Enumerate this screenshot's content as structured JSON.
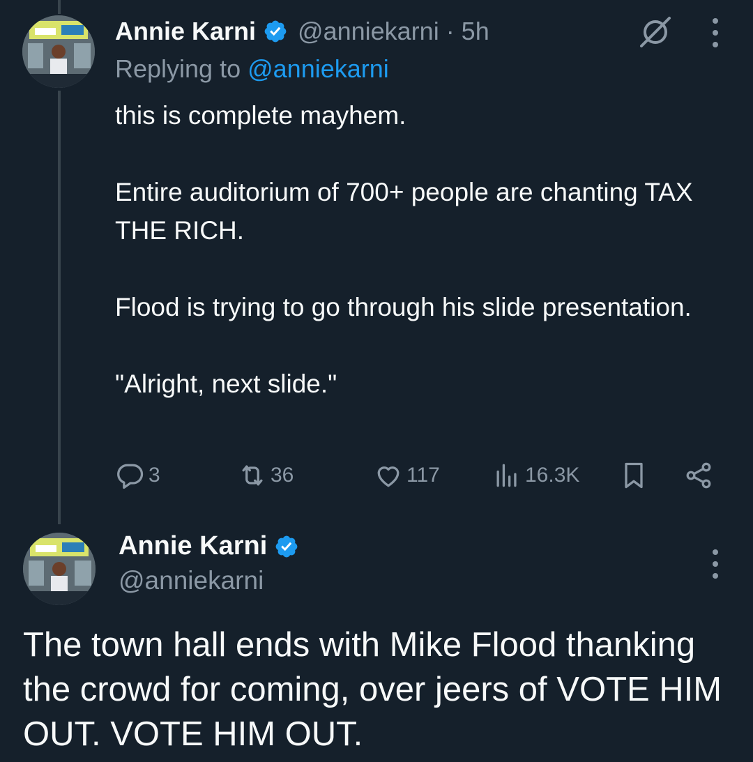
{
  "colors": {
    "background": "#15202b",
    "text_primary": "#f7f9f9",
    "text_secondary": "#8b98a5",
    "link": "#1d9bf0",
    "verified": "#1d9bf0",
    "thread_line": "#38444d"
  },
  "tweet1": {
    "author_name": "Annie Karni",
    "handle_time": "@anniekarni · 5h",
    "replying_prefix": "Replying to ",
    "replying_handle": "@anniekarni",
    "paragraphs": [
      "this is complete mayhem.",
      "Entire auditorium of 700+ people are chanting TAX THE RICH.",
      "Flood is trying to go through his slide presentation.",
      "\"Alright, next slide.\""
    ],
    "replies": "3",
    "retweets": "36",
    "likes": "117",
    "views": "16.3K",
    "icons": [
      "grok-icon",
      "more-icon",
      "reply-icon",
      "retweet-icon",
      "like-icon",
      "views-icon",
      "bookmark-icon",
      "share-icon"
    ]
  },
  "tweet2": {
    "author_name": "Annie Karni",
    "handle": "@anniekarni",
    "text": "The town hall ends with Mike Flood thanking the crowd for coming, over jeers of VOTE HIM OUT. VOTE HIM OUT.",
    "icons": [
      "more-icon"
    ]
  }
}
